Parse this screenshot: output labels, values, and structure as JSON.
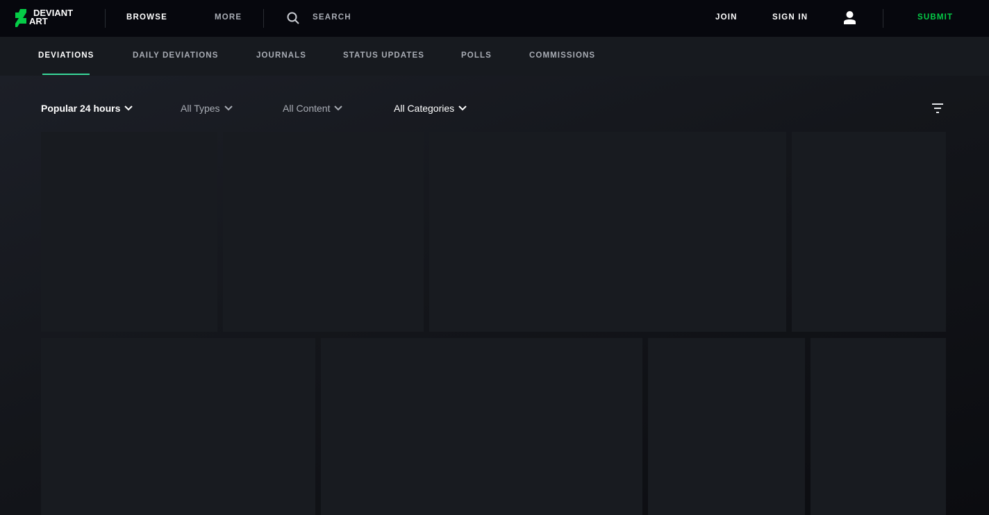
{
  "header": {
    "logo_text": "DEVIANT ART",
    "browse": "BROWSE",
    "more": "MORE",
    "search": "SEARCH",
    "join": "JOIN",
    "sign_in": "SIGN IN",
    "submit": "SUBMIT"
  },
  "tabs": [
    "DEVIATIONS",
    "DAILY DEVIATIONS",
    "JOURNALS",
    "STATUS UPDATES",
    "POLLS",
    "COMMISSIONS"
  ],
  "filters": [
    "Popular 24 hours",
    "All Types",
    "All Content",
    "All Categories"
  ],
  "colors": {
    "accent": "#05cc47",
    "underline": "#3ad99b"
  }
}
